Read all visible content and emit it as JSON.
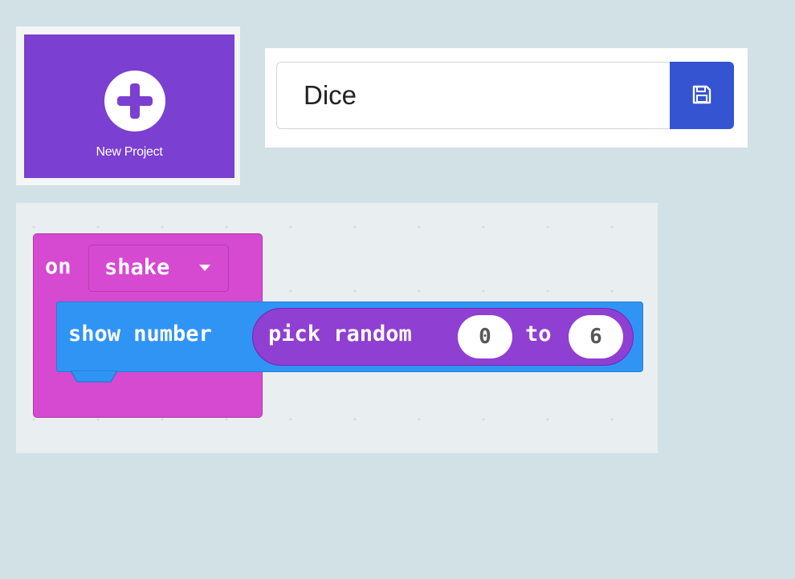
{
  "new_project": {
    "label": "New Project",
    "icon": "plus-circle-icon",
    "color": "#7b3fd1"
  },
  "project_name": {
    "value": "Dice",
    "save_icon": "save-icon",
    "save_color": "#3454d1"
  },
  "workspace": {
    "event_block": {
      "prefix": "on",
      "dropdown_value": "shake",
      "color": "#d54ad0"
    },
    "statement_block": {
      "label": "show number",
      "color": "#3094f5"
    },
    "reporter_block": {
      "label": "pick random",
      "from_value": "0",
      "connector": "to",
      "to_value": "6",
      "color": "#8f3fd2"
    }
  }
}
